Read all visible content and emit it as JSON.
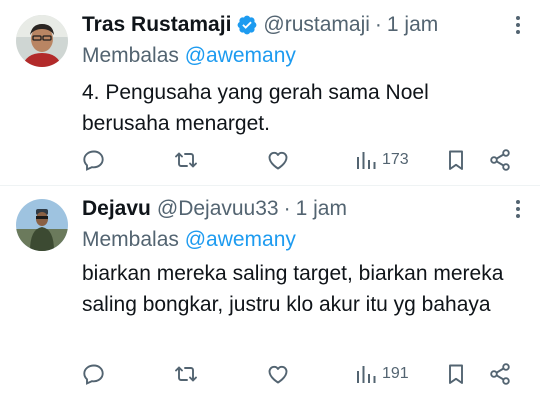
{
  "tweets": [
    {
      "name": "Tras Rustamaji",
      "verified": true,
      "handle": "@rustamaji",
      "separator": "·",
      "time": "1 jam",
      "reply_prefix": "Membalas",
      "reply_to": "@awemany",
      "text": "4. Pengusaha yang gerah sama Noel berusaha menarget.",
      "views": "173",
      "icons": [
        "reply-icon",
        "retweet-icon",
        "like-icon",
        "views-icon",
        "bookmark-icon",
        "share-icon",
        "more-icon"
      ]
    },
    {
      "name": "Dejavu",
      "verified": false,
      "handle": "@Dejavuu33",
      "separator": "·",
      "time": "1 jam",
      "reply_prefix": "Membalas",
      "reply_to": "@awemany",
      "text": "biarkan mereka saling target, biarkan mereka saling bongkar, justru klo akur itu yg bahaya",
      "views": "191",
      "icons": [
        "reply-icon",
        "retweet-icon",
        "like-icon",
        "views-icon",
        "bookmark-icon",
        "share-icon",
        "more-icon"
      ]
    }
  ],
  "colors": {
    "accent": "#1d9bf0",
    "secondary_text": "#536471",
    "primary_text": "#0f1419",
    "divider": "#eff3f4"
  }
}
